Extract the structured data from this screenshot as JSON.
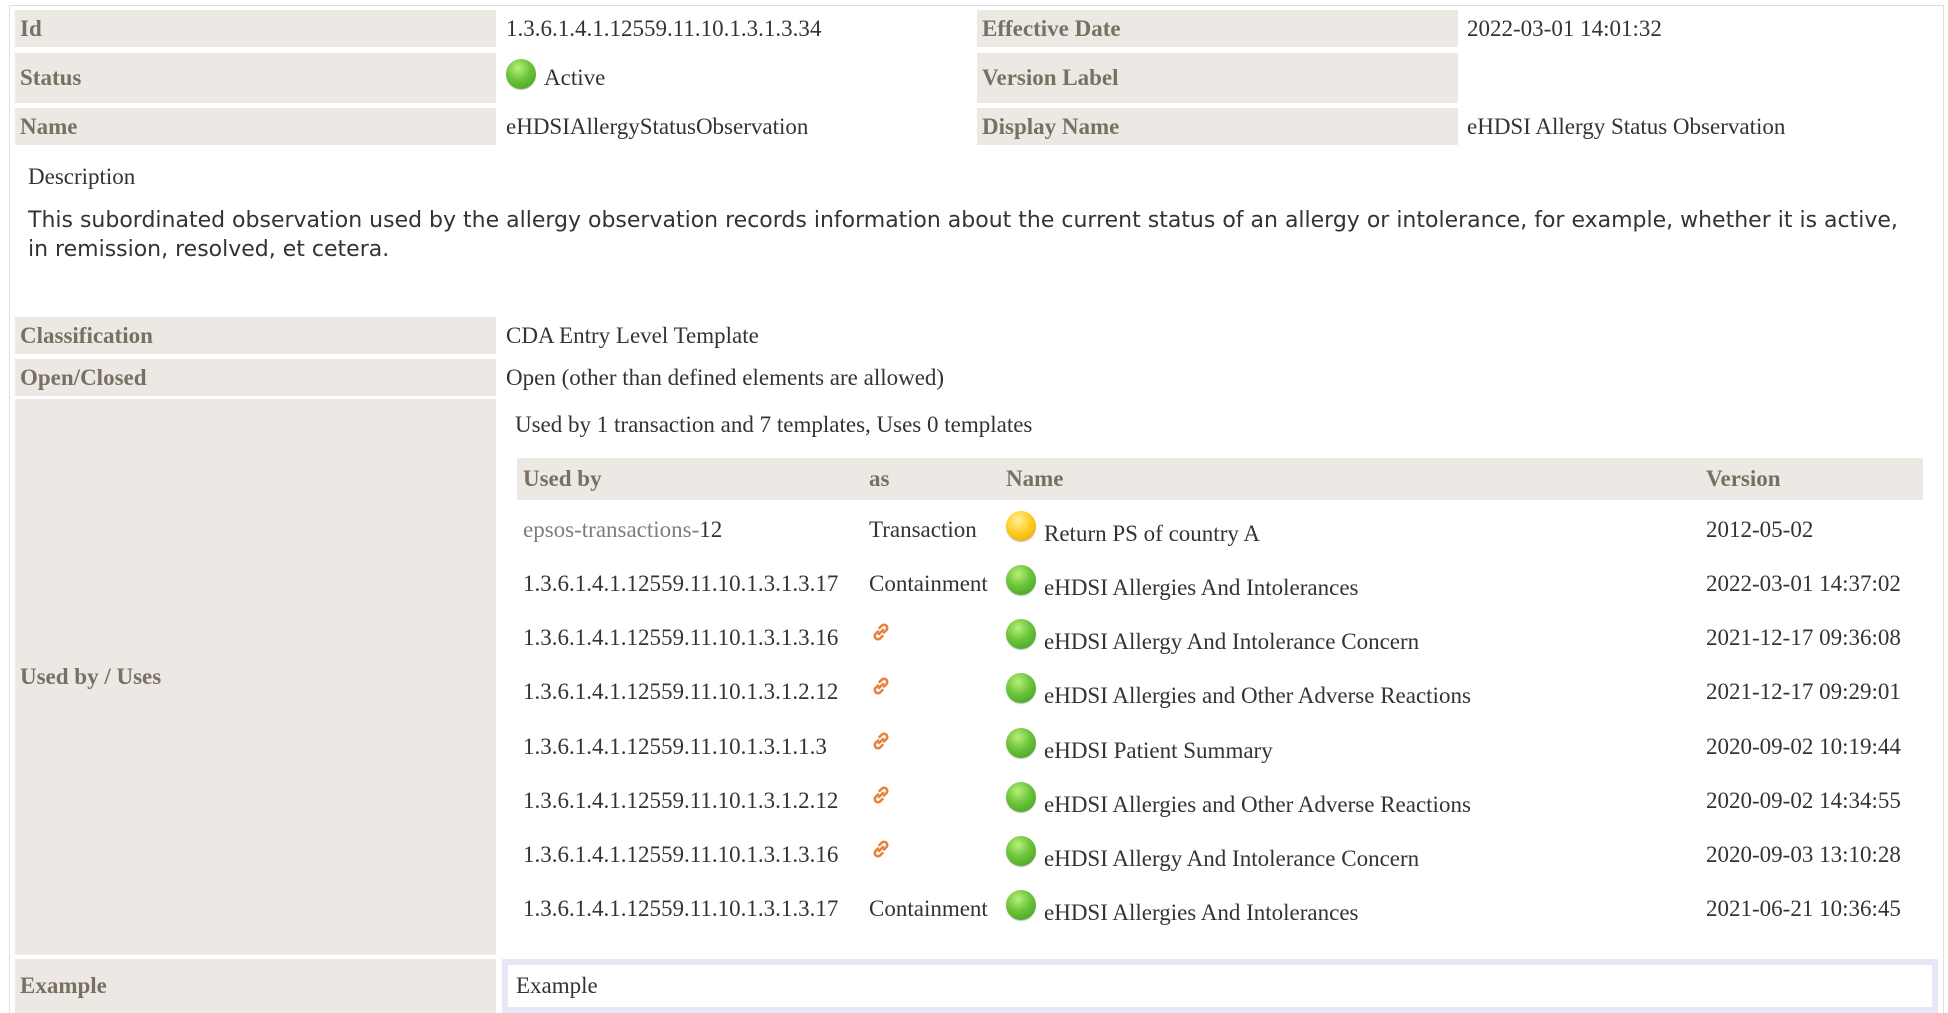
{
  "header": {
    "id": {
      "label": "Id",
      "value": "1.3.6.1.4.1.12559.11.10.1.3.1.3.34"
    },
    "effective_date": {
      "label": "Effective Date",
      "value": "2022-03-01 14:01:32"
    },
    "status": {
      "label": "Status",
      "value": "Active",
      "color": "#6cc43a"
    },
    "version_label": {
      "label": "Version Label",
      "value": ""
    },
    "name": {
      "label": "Name",
      "value": "eHDSIAllergyStatusObservation"
    },
    "display_name": {
      "label": "Display Name",
      "value": "eHDSI Allergy Status Observation"
    }
  },
  "description": {
    "heading": "Description",
    "text": "This subordinated observation used by the allergy observation records information about the current status of an allergy or intolerance, for example, whether it is active, in remission, resolved, et cetera."
  },
  "classification": {
    "label": "Classification",
    "value": "CDA Entry Level Template"
  },
  "open_closed": {
    "label": "Open/Closed",
    "value": "Open (other than defined elements are allowed)"
  },
  "used_by": {
    "label": "Used by / Uses",
    "summary": "Used by 1 transaction and 7 templates, Uses 0 templates",
    "columns": [
      "Used by",
      "as",
      "Name",
      "Version"
    ],
    "rows": [
      {
        "id_prefix": "epsos-transactions-",
        "id": "12",
        "as": "Transaction",
        "as_icon": "",
        "status_icon": "yellow-dot-icon",
        "name": "Return PS of country A",
        "version": "2012-05-02"
      },
      {
        "id_prefix": "",
        "id": "1.3.6.1.4.1.12559.11.10.1.3.1.3.17",
        "as": "Containment",
        "as_icon": "",
        "status_icon": "green-dot-icon",
        "name": "eHDSI Allergies And Intolerances",
        "version": "2022-03-01 14:37:02"
      },
      {
        "id_prefix": "",
        "id": "1.3.6.1.4.1.12559.11.10.1.3.1.3.16",
        "as": "",
        "as_icon": "link-icon",
        "status_icon": "green-dot-icon",
        "name": "eHDSI Allergy And Intolerance Concern",
        "version": "2021-12-17 09:36:08"
      },
      {
        "id_prefix": "",
        "id": "1.3.6.1.4.1.12559.11.10.1.3.1.2.12",
        "as": "",
        "as_icon": "link-icon",
        "status_icon": "green-dot-icon",
        "name": "eHDSI Allergies and Other Adverse Reactions",
        "version": "2021-12-17 09:29:01"
      },
      {
        "id_prefix": "",
        "id": "1.3.6.1.4.1.12559.11.10.1.3.1.1.3",
        "as": "",
        "as_icon": "link-icon",
        "status_icon": "green-dot-icon",
        "name": "eHDSI Patient Summary",
        "version": "2020-09-02 10:19:44"
      },
      {
        "id_prefix": "",
        "id": "1.3.6.1.4.1.12559.11.10.1.3.1.2.12",
        "as": "",
        "as_icon": "link-icon",
        "status_icon": "green-dot-icon",
        "name": "eHDSI Allergies and Other Adverse Reactions",
        "version": "2020-09-02 14:34:55"
      },
      {
        "id_prefix": "",
        "id": "1.3.6.1.4.1.12559.11.10.1.3.1.3.16",
        "as": "",
        "as_icon": "link-icon",
        "status_icon": "green-dot-icon",
        "name": "eHDSI Allergy And Intolerance Concern",
        "version": "2020-09-03 13:10:28"
      },
      {
        "id_prefix": "",
        "id": "1.3.6.1.4.1.12559.11.10.1.3.1.3.17",
        "as": "Containment",
        "as_icon": "",
        "status_icon": "green-dot-icon",
        "name": "eHDSI Allergies And Intolerances",
        "version": "2021-06-21 10:36:45"
      }
    ]
  },
  "example": {
    "label": "Example",
    "value": "Example"
  },
  "colors": {
    "label_bg": "#ece9e4",
    "label_text": "#7a7062",
    "link_orange": "#e8823a",
    "example_border": "#e6e8f7"
  }
}
